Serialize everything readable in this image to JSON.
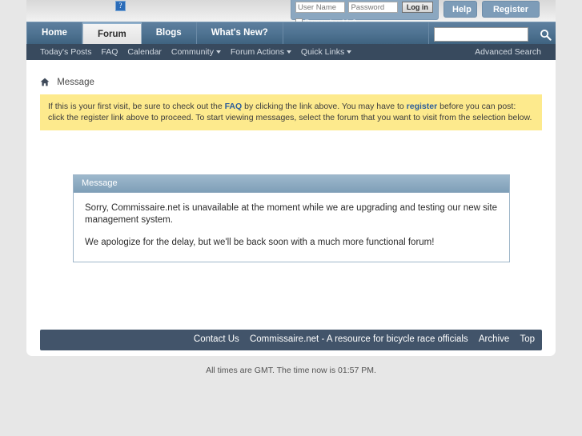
{
  "header": {
    "logo_alt": "?",
    "login": {
      "username_placeholder": "User Name",
      "password_placeholder": "Password",
      "username_value": "",
      "password_value": "",
      "login_label": "Log in",
      "remember_label": "Remember Me?"
    },
    "help_label": "Help",
    "register_label": "Register"
  },
  "nav": {
    "tabs": [
      {
        "label": "Home",
        "active": false
      },
      {
        "label": "Forum",
        "active": true
      },
      {
        "label": "Blogs",
        "active": false
      },
      {
        "label": "What's New?",
        "active": false
      }
    ],
    "search_placeholder": "",
    "search_value": "",
    "search_icon": "search-icon"
  },
  "subnav": {
    "items": [
      {
        "label": "Today's Posts",
        "caret": false
      },
      {
        "label": "FAQ",
        "caret": false
      },
      {
        "label": "Calendar",
        "caret": false
      },
      {
        "label": "Community",
        "caret": true
      },
      {
        "label": "Forum Actions",
        "caret": true
      },
      {
        "label": "Quick Links",
        "caret": true
      }
    ],
    "advanced_search": "Advanced Search"
  },
  "breadcrumb": {
    "home_icon": "home-icon",
    "label": "Message"
  },
  "notice": {
    "text_1": "If this is your first visit, be sure to check out the ",
    "link_faq": "FAQ",
    "text_2": " by clicking the link above. You may have to ",
    "link_register": "register",
    "text_3": " before you can post: click the register link above to proceed. To start viewing messages, select the forum that you want to visit from the selection below."
  },
  "message_panel": {
    "title": "Message",
    "paragraphs": [
      "Sorry, Commissaire.net is unavailable at the moment while we are upgrading and testing our new site management system.",
      "We apologize for the delay, but we'll be back soon with a much more functional forum!"
    ]
  },
  "footer": {
    "links": [
      "Contact Us",
      "Commissaire.net - A resource for bicycle race officials",
      "Archive",
      "Top"
    ],
    "timestamp": "All times are GMT. The time now is 01:57 PM."
  },
  "colors": {
    "page_bg": "#e7e7e7",
    "nav_bar": "#4f7392",
    "subnav_bar": "#384a5e",
    "notice_bg": "#fdea8d",
    "footer_bar": "#42546a",
    "link_blue": "#2c5d9b",
    "panel_head": "#8fadc4"
  }
}
